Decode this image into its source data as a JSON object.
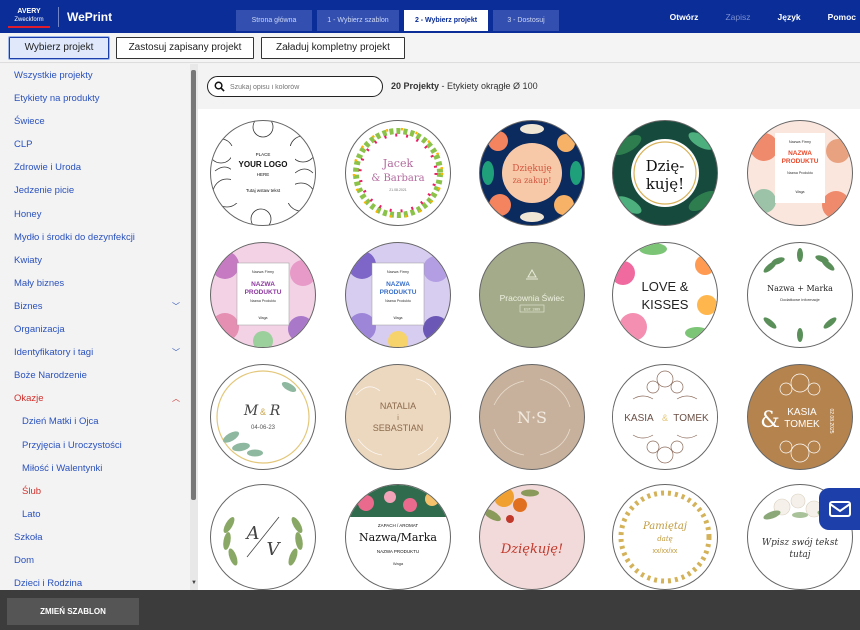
{
  "brand": {
    "avery_top": "AVERY",
    "avery_sub": "Zweckform",
    "product": "WePrint"
  },
  "steps": [
    {
      "label": "Strona główna",
      "active": false
    },
    {
      "label": "1 - Wybierz szablon",
      "active": false
    },
    {
      "label": "2 - Wybierz projekt",
      "active": true
    },
    {
      "label": "3 - Dostosuj",
      "active": false
    }
  ],
  "topnav": {
    "open": "Otwórz",
    "save": "Zapisz",
    "language": "Język",
    "help": "Pomoc"
  },
  "modes": {
    "choose": "Wybierz projekt",
    "apply_saved": "Zastosuj zapisany projekt",
    "load_full": "Załaduj kompletny projekt"
  },
  "sidebar": {
    "items": [
      {
        "label": "Wszystkie projekty"
      },
      {
        "label": "Etykiety na produkty"
      },
      {
        "label": "Świece"
      },
      {
        "label": "CLP"
      },
      {
        "label": "Zdrowie i Uroda"
      },
      {
        "label": "Jedzenie picie"
      },
      {
        "label": "Honey"
      },
      {
        "label": "Mydło i środki do dezynfekcji"
      },
      {
        "label": "Kwiaty"
      },
      {
        "label": "Mały biznes"
      },
      {
        "label": "Biznes",
        "chevron": "v"
      },
      {
        "label": "Organizacja"
      },
      {
        "label": "Identyfikatory i tagi",
        "chevron": "v"
      },
      {
        "label": "Boże Narodzenie"
      },
      {
        "label": "Okazje",
        "chevron": "^",
        "selected": true
      },
      {
        "label": "Dzień Matki i Ojca",
        "sub": true
      },
      {
        "label": "Przyjęcia i Uroczystości",
        "sub": true
      },
      {
        "label": "Miłość i Walentynki",
        "sub": true
      },
      {
        "label": "Ślub",
        "sub": true,
        "selected": true
      },
      {
        "label": "Lato",
        "sub": true
      },
      {
        "label": "Szkoła"
      },
      {
        "label": "Dom"
      },
      {
        "label": "Dzieci i Rodzina"
      }
    ]
  },
  "search": {
    "placeholder": "Szukaj opisu i kolorów",
    "count": "20 Projekty",
    "template": " - Etykiety okrągłe Ø 100"
  },
  "designs": {
    "d1": {
      "l1": "PLACE",
      "l2": "YOUR LOGO",
      "l3": "HERE",
      "l4": "Tutaj wstaw tekst"
    },
    "d2": {
      "l1": "Jacek",
      "l2": "& Barbara",
      "l3": "21.08.2021"
    },
    "d3": {
      "l1": "Dziękuję",
      "l2": "za zakup!"
    },
    "d4": {
      "l1": "Dzię-",
      "l2": "kuję!"
    },
    "d5": {
      "l1": "Nazwa Firmy",
      "l2": "NAZWA",
      "l3": "PRODUKTU",
      "l4": "Nazwa Produktu",
      "l5": "Waga"
    },
    "d6": {
      "l1": "Nazwa Firmy",
      "l2": "NAZWA",
      "l3": "PRODUKTU",
      "l4": "Nazwa Produktu",
      "l5": "Waga"
    },
    "d7": {
      "l1": "Nazwa Firmy",
      "l2": "NAZWA",
      "l3": "PRODUKTU",
      "l4": "Nazwa Produktu",
      "l5": "Waga"
    },
    "d8": {
      "l1": "Pracownia Świec",
      "l2": "EST. 1989"
    },
    "d9": {
      "l1": "LOVE &",
      "l2": "KISSES"
    },
    "d10": {
      "l1": "Nazwa + Marka",
      "l2": "Dodatkowe informacje"
    },
    "d11": {
      "l1": "M",
      "l2": "&",
      "l3": "R",
      "l4": "04-06-23"
    },
    "d12": {
      "l1": "NATALIA",
      "l2": "i",
      "l3": "SEBASTIAN"
    },
    "d13": {
      "l1": "N·S"
    },
    "d14": {
      "l1": "KASIA",
      "l2": "&",
      "l3": "TOMEK"
    },
    "d15": {
      "l1": "&",
      "l2": "KASIA",
      "l3": "TOMEK",
      "l4": "02.08.2025"
    },
    "d16": {
      "l1": "A",
      "l2": "V"
    },
    "d17": {
      "l1": "ZAPACH / AROMAT",
      "l2": "Nazwa/Marka",
      "l3": "NAZWA PRODUKTU",
      "l4": "Waga"
    },
    "d18": {
      "l1": "Dziękuję!"
    },
    "d19": {
      "l1": "Pamiętaj",
      "l2": "datę",
      "l3": "xx/xx/xx"
    },
    "d20": {
      "l1": "Wpisz swój tekst",
      "l2": "tutaj"
    }
  },
  "bottom": {
    "change_template": "ZMIEŃ SZABLON"
  },
  "colors": {
    "header_blue": "#0a2d97",
    "link_blue": "#2a52be",
    "active_red": "#d0312d",
    "bottom_gray": "#3c3c3c"
  }
}
